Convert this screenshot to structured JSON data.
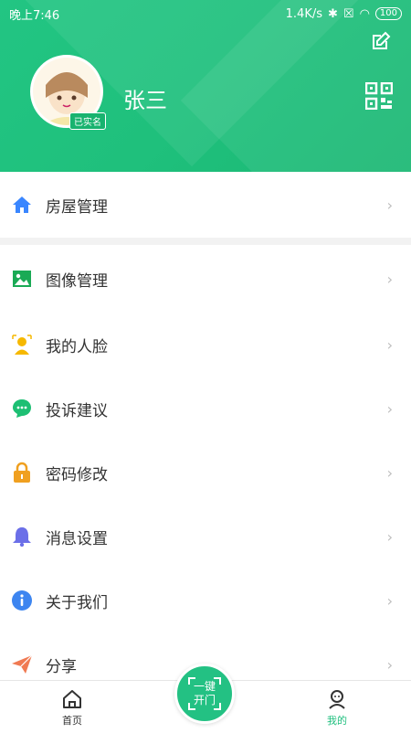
{
  "status_bar": {
    "time": "晚上7:46",
    "speed": "1.4K/s",
    "battery": "100"
  },
  "profile": {
    "name": "张三",
    "verified_badge": "已实名"
  },
  "menu": {
    "first": {
      "label": "房屋管理",
      "icon": "home-icon"
    },
    "items": [
      {
        "label": "图像管理",
        "icon": "image-icon"
      },
      {
        "label": "我的人脸",
        "icon": "face-icon"
      },
      {
        "label": "投诉建议",
        "icon": "chat-icon"
      },
      {
        "label": "密码修改",
        "icon": "lock-icon"
      },
      {
        "label": "消息设置",
        "icon": "bell-icon"
      },
      {
        "label": "关于我们",
        "icon": "info-icon"
      },
      {
        "label": "分享",
        "icon": "share-icon"
      }
    ]
  },
  "tabbar": {
    "home": "首页",
    "mine": "我的",
    "open_line1": "一键",
    "open_line2": "开门"
  },
  "colors": {
    "brand": "#1fbf7e",
    "home_icon": "#3a86ff",
    "image_icon": "#1aaa55",
    "face_icon": "#f6b800",
    "chat_icon": "#1dbf73",
    "lock_icon": "#f0a020",
    "bell_icon": "#6b6fe8",
    "info_icon": "#3d85f0",
    "share_icon": "#f07a52"
  }
}
